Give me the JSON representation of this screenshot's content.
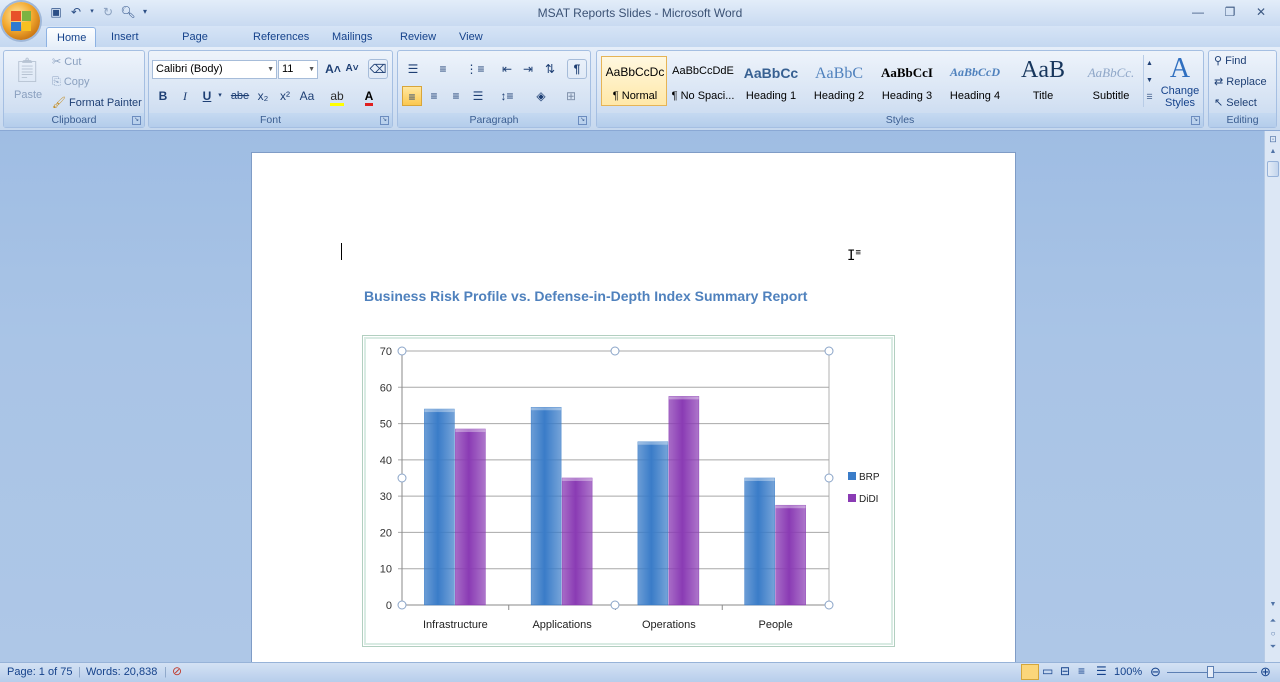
{
  "window": {
    "title": "MSAT Reports Slides - Microsoft Word",
    "controls": [
      "minimize-icon",
      "restore-icon",
      "close-icon"
    ]
  },
  "quick_access": [
    "save-icon",
    "undo-icon",
    "redo-icon",
    "print-preview-icon",
    "customize-qat-icon"
  ],
  "tabs": [
    {
      "label": "Home",
      "active": true
    },
    {
      "label": "Insert"
    },
    {
      "label": "Page Layout"
    },
    {
      "label": "References"
    },
    {
      "label": "Mailings"
    },
    {
      "label": "Review"
    },
    {
      "label": "View"
    }
  ],
  "ribbon": {
    "clipboard": {
      "label": "Clipboard",
      "paste": "Paste",
      "cut": "Cut",
      "copy": "Copy",
      "format_painter": "Format Painter"
    },
    "font": {
      "label": "Font",
      "font_name": "Calibri (Body)",
      "font_size": "11",
      "buttons": [
        "B",
        "I",
        "U",
        "abe",
        "x₂",
        "x²",
        "Aa"
      ]
    },
    "paragraph": {
      "label": "Paragraph"
    },
    "styles": {
      "label": "Styles",
      "items": [
        {
          "sample": "AaBbCcDc",
          "name": "¶ Normal",
          "selected": true
        },
        {
          "sample": "AaBbCcDdE",
          "name": "¶ No Spaci..."
        },
        {
          "sample": "AaBbCc",
          "name": "Heading 1"
        },
        {
          "sample": "AaBbC",
          "name": "Heading 2"
        },
        {
          "sample": "AaBbCcI",
          "name": "Heading 3"
        },
        {
          "sample": "AaBbCcD",
          "name": "Heading 4"
        },
        {
          "sample": "AaB",
          "name": "Title"
        },
        {
          "sample": "AaBbCc.",
          "name": "Subtitle"
        }
      ],
      "change_styles": "Change Styles"
    },
    "editing": {
      "label": "Editing",
      "find": "Find",
      "replace": "Replace",
      "select": "Select"
    }
  },
  "document": {
    "heading": "Business Risk Profile vs. Defense-in-Depth Index Summary Report"
  },
  "chart_data": {
    "type": "bar",
    "title": "",
    "categories": [
      "Infrastructure",
      "Applications",
      "Operations",
      "People"
    ],
    "series": [
      {
        "name": "BRP",
        "values": [
          54,
          54.5,
          45,
          35
        ],
        "color": "#3a7cc8"
      },
      {
        "name": "DiDI",
        "values": [
          48.5,
          35,
          57.5,
          27.5
        ],
        "color": "#8a3bb4"
      }
    ],
    "ylim": [
      0,
      70
    ],
    "yticks": [
      "0",
      "10",
      "20",
      "30",
      "40",
      "50",
      "60",
      "70"
    ],
    "grid": true,
    "legend": "right"
  },
  "status": {
    "page": "Page: 1 of 75",
    "words": "Words: 20,838",
    "zoom": "100%"
  }
}
